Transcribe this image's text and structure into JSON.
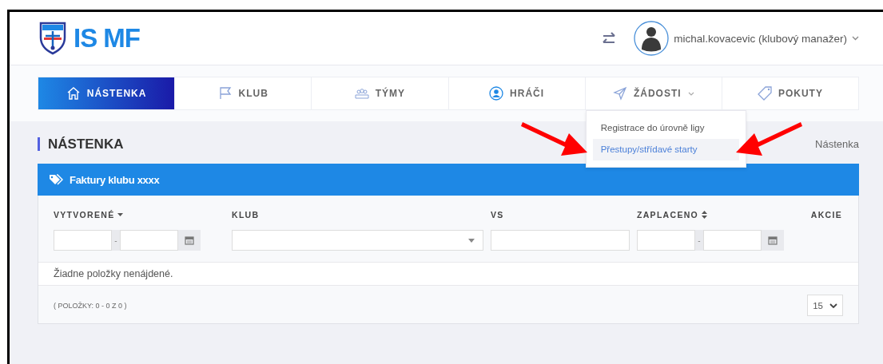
{
  "header": {
    "logo_text": "IS MF",
    "user": {
      "name": "michal.kovacevic (klubový manažer)"
    }
  },
  "nav": {
    "tabs": [
      {
        "label": "NÁSTENKA",
        "kind": "home",
        "selected": true
      },
      {
        "label": "KLUB",
        "kind": "flag",
        "selected": false
      },
      {
        "label": "TÝMY",
        "kind": "team",
        "selected": false
      },
      {
        "label": "HRÁČI",
        "kind": "player",
        "selected": false
      },
      {
        "label": "ŽÁDOSTI",
        "kind": "send",
        "selected": false,
        "expanded": true,
        "menu": [
          {
            "label": "Registrace do úrovně ligy",
            "selected": false
          },
          {
            "label": "Přestupy/střídavé starty",
            "selected": true
          }
        ]
      },
      {
        "label": "POKUTY",
        "kind": "tag",
        "selected": false
      }
    ]
  },
  "page": {
    "title": "NÁSTENKA",
    "breadcrumb": "Nástenka"
  },
  "card": {
    "title": "Faktury klubu xxxx",
    "columns": [
      {
        "label": "VYTVORENÉ",
        "kind": "daterange",
        "range_separator": "-"
      },
      {
        "label": "KLUB",
        "kind": "select"
      },
      {
        "label": "VS",
        "kind": "text"
      },
      {
        "label": "ZAPLACENO",
        "kind": "daterange",
        "range_separator": "-"
      },
      {
        "label": "AKCIE",
        "kind": "actions"
      }
    ],
    "empty_message": "Žiadne položky nenájdené.",
    "pagination": "( POLOŽKY: 0 - 0 Z 0 )",
    "page_size": "15"
  },
  "annotation_arrows": [
    {
      "kind": "arrow"
    },
    {
      "kind": "arrow"
    }
  ]
}
